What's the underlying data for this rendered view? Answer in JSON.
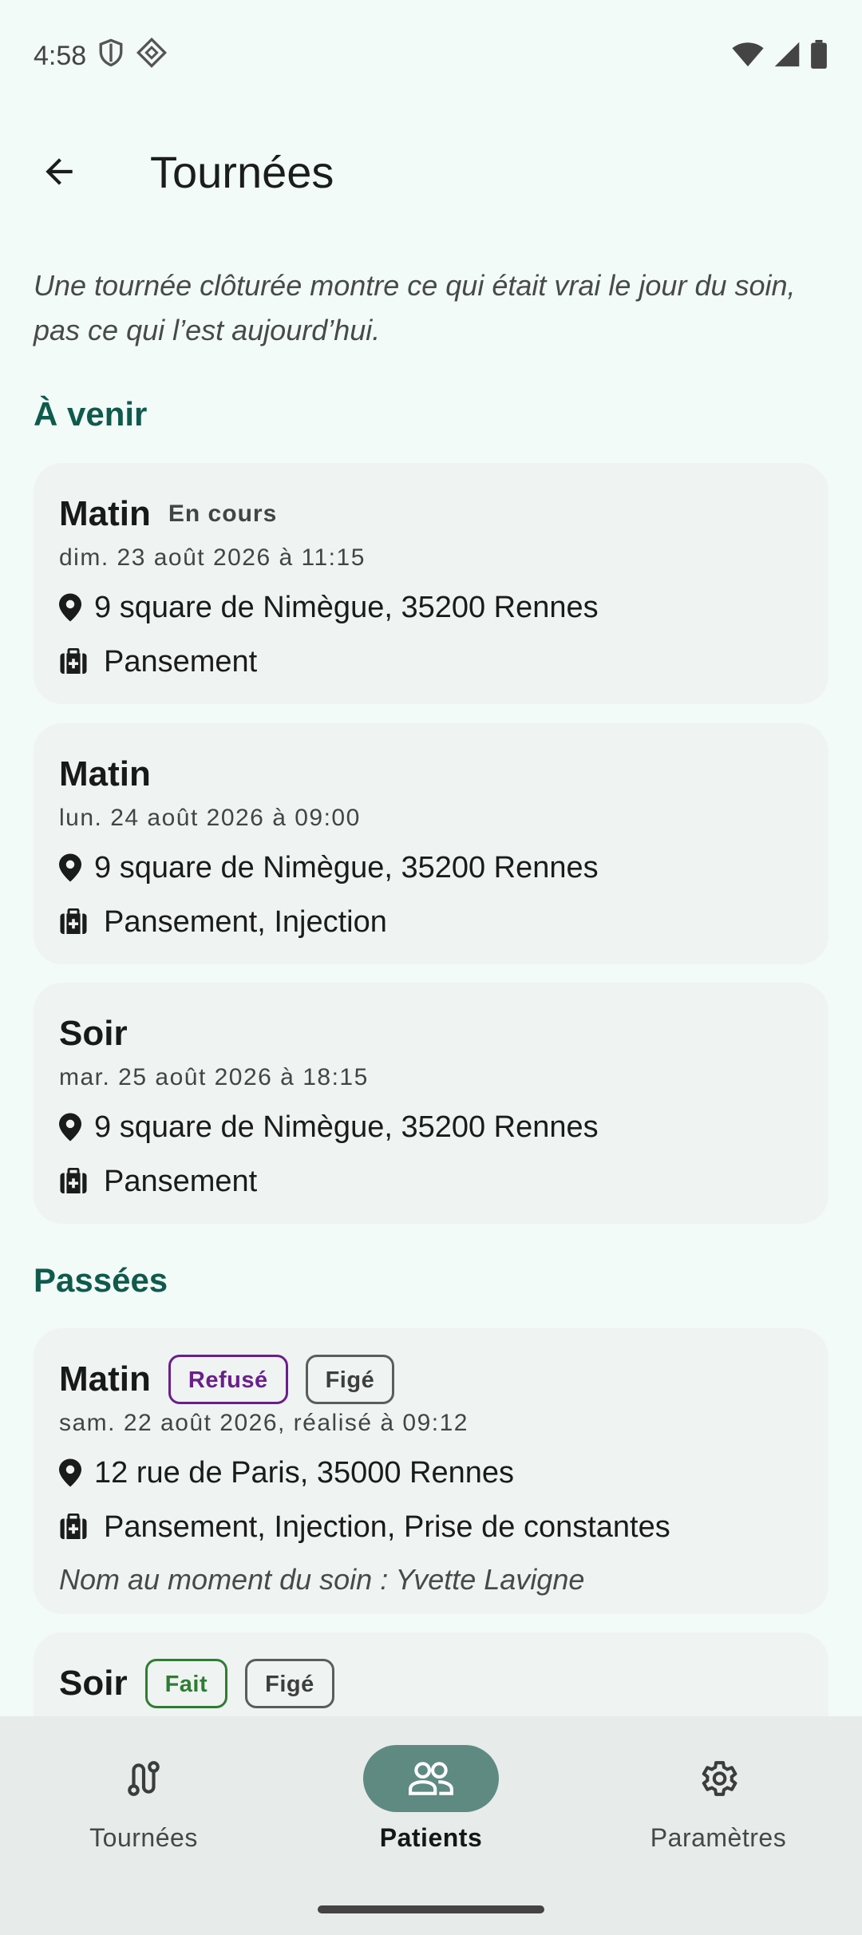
{
  "status_bar": {
    "time": "4:58"
  },
  "app_bar": {
    "title": "Tournées"
  },
  "intro": "Une tournée clôturée montre ce qui était vrai le jour du soin, pas ce qui l’est aujourd’hui.",
  "sections": {
    "upcoming": "À venir",
    "past": "Passées"
  },
  "upcoming_cards": [
    {
      "title": "Matin",
      "status": "En cours",
      "date": "dim. 23 août 2026 à 11:15",
      "address": "9 square de Nimègue, 35200 Rennes",
      "care": "Pansement"
    },
    {
      "title": "Matin",
      "date": "lun. 24 août 2026 à 09:00",
      "address": "9 square de Nimègue, 35200 Rennes",
      "care": "Pansement, Injection"
    },
    {
      "title": "Soir",
      "date": "mar. 25 août 2026 à 18:15",
      "address": "9 square de Nimègue, 35200 Rennes",
      "care": "Pansement"
    }
  ],
  "past_cards": [
    {
      "title": "Matin",
      "badges": [
        "Refusé",
        "Figé"
      ],
      "date": "sam. 22 août 2026, réalisé à 09:12",
      "address": "12 rue de Paris, 35000 Rennes",
      "care": "Pansement, Injection, Prise de constantes",
      "note": "Nom au moment du soin : Yvette Lavigne"
    },
    {
      "title": "Soir",
      "badges": [
        "Fait",
        "Figé"
      ]
    }
  ],
  "bottom_nav": [
    {
      "label": "Tournées",
      "icon": "route-icon",
      "active": false
    },
    {
      "label": "Patients",
      "icon": "people-icon",
      "active": true
    },
    {
      "label": "Paramètres",
      "icon": "gear-icon",
      "active": false
    }
  ],
  "colors": {
    "accent": "#0f5a4c",
    "refused": "#6b1f8a",
    "done": "#2e7d32",
    "nav_active": "#5e8a82"
  }
}
